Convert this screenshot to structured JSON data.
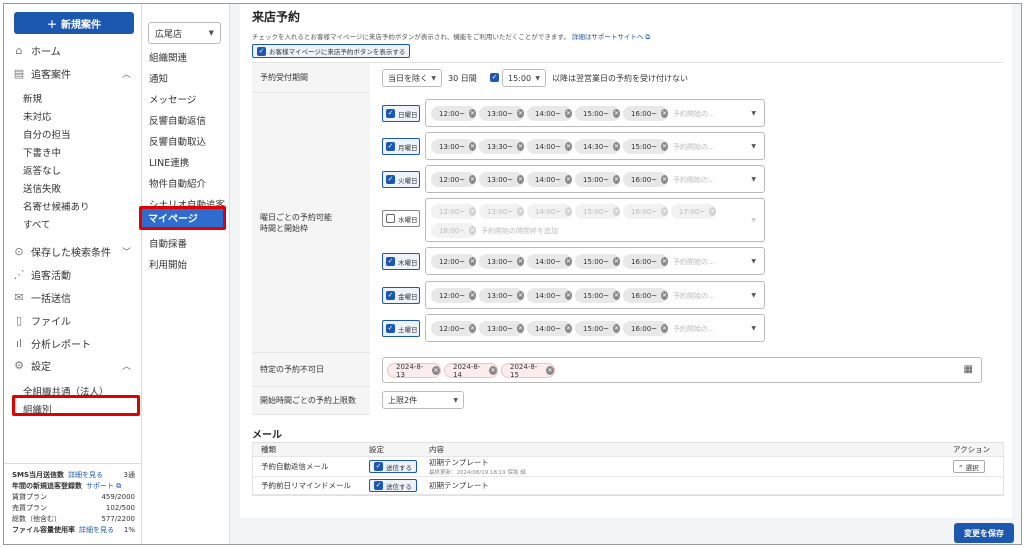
{
  "sidebar": {
    "new_button": "新規案件",
    "main_items": [
      {
        "label": "ホーム",
        "icon": "home-icon"
      },
      {
        "label": "追客案件",
        "icon": "list-icon"
      },
      {
        "label": "保存した検索条件",
        "icon": "saved-search-icon"
      },
      {
        "label": "追客活動",
        "icon": "activity-icon"
      },
      {
        "label": "一括送信",
        "icon": "mail-icon"
      },
      {
        "label": "ファイル",
        "icon": "file-icon"
      },
      {
        "label": "分析レポート",
        "icon": "chart-icon"
      },
      {
        "label": "設定",
        "icon": "gear-icon"
      }
    ],
    "case_sub_items": [
      "新規",
      "未対応",
      "自分の担当",
      "下書き中",
      "返答なし",
      "送信失敗",
      "名寄せ候補あり",
      "すべて"
    ],
    "settings_sub_items": [
      "全組織共通（法人）",
      "組織別"
    ],
    "stats": {
      "sms_label": "SMS当月送信数",
      "sms_link": "詳細を見る",
      "sms_value": "3通",
      "yearly_label": "年間の新規追客登録数",
      "yearly_link": "サポート",
      "rent_label": "賃貸プラン",
      "rent_value": "459/2000",
      "sale_label": "売買プラン",
      "sale_value": "102/500",
      "total_label": "総数（他含む）",
      "total_value": "577/2200",
      "file_label": "ファイル容量使用率",
      "file_link": "詳細を見る",
      "file_value": "1%"
    }
  },
  "col2": {
    "store": "広尾店",
    "items": [
      "組織関連",
      "通知",
      "メッセージ",
      "反響自動返信",
      "反響自動取込",
      "LINE連携",
      "物件自動紹介",
      "シナリオ自動追客",
      "マイページ",
      "自動採番",
      "利用開始"
    ],
    "active": "マイページ"
  },
  "main": {
    "title": "来店予約",
    "description": "チェックを入れるとお客様マイページに来店予約ボタンが表示され、機能をご利用いただくことができます。",
    "description_link": "詳細はサポートサイトへ",
    "show_button": "お客様マイページに来店予約ボタンを表示する",
    "reception": {
      "label": "予約受付期間",
      "today_option": "当日を除く",
      "days": "30 日間",
      "time": "15:00",
      "suffix": "以降は翌営業日の予約を受け付けない"
    },
    "weekday_label_1": "曜日ごとの予約可能",
    "weekday_label_2": "時間と開始枠",
    "slot_placeholder": "予約開始の...",
    "wed_placeholder": "予約開始の時間枠を追加",
    "days": [
      {
        "name": "日曜日",
        "checked": true,
        "slots": [
          "12:00~",
          "13:00~",
          "14:00~",
          "15:00~",
          "16:00~"
        ]
      },
      {
        "name": "月曜日",
        "checked": true,
        "slots": [
          "13:00~",
          "13:30~",
          "14:00~",
          "14:30~",
          "15:00~"
        ]
      },
      {
        "name": "火曜日",
        "checked": true,
        "slots": [
          "12:00~",
          "13:00~",
          "14:00~",
          "15:00~",
          "16:00~"
        ]
      },
      {
        "name": "水曜日",
        "checked": false,
        "slots": [
          "12:00~",
          "13:00~",
          "14:00~",
          "15:00~",
          "16:00~",
          "17:00~",
          "18:00~"
        ]
      },
      {
        "name": "木曜日",
        "checked": true,
        "slots": [
          "12:00~",
          "13:00~",
          "14:00~",
          "15:00~",
          "16:00~"
        ]
      },
      {
        "name": "金曜日",
        "checked": true,
        "slots": [
          "12:00~",
          "13:00~",
          "14:00~",
          "15:00~",
          "16:00~"
        ]
      },
      {
        "name": "土曜日",
        "checked": true,
        "slots": [
          "12:00~",
          "13:00~",
          "14:00~",
          "15:00~",
          "16:00~"
        ]
      }
    ],
    "blackout": {
      "label": "特定の予約不可日",
      "dates": [
        "2024-8-13",
        "2024-8-14",
        "2024-8-15"
      ]
    },
    "limit": {
      "label": "開始時間ごとの予約上限数",
      "value": "上限2件"
    },
    "mail": {
      "title": "メール",
      "headers": [
        "種類",
        "設定",
        "内容",
        "アクション"
      ],
      "rows": [
        {
          "type": "予約自動返信メール",
          "setting": "送信する",
          "content": "初期テンプレート",
          "sub": "最終更新：2024/08/19 18:19 保坂 誠",
          "action": "選択"
        },
        {
          "type": "予約前日リマインドメール",
          "setting": "送信する",
          "content": "初期テンプレート"
        }
      ]
    },
    "save_button": "変更を保存"
  }
}
